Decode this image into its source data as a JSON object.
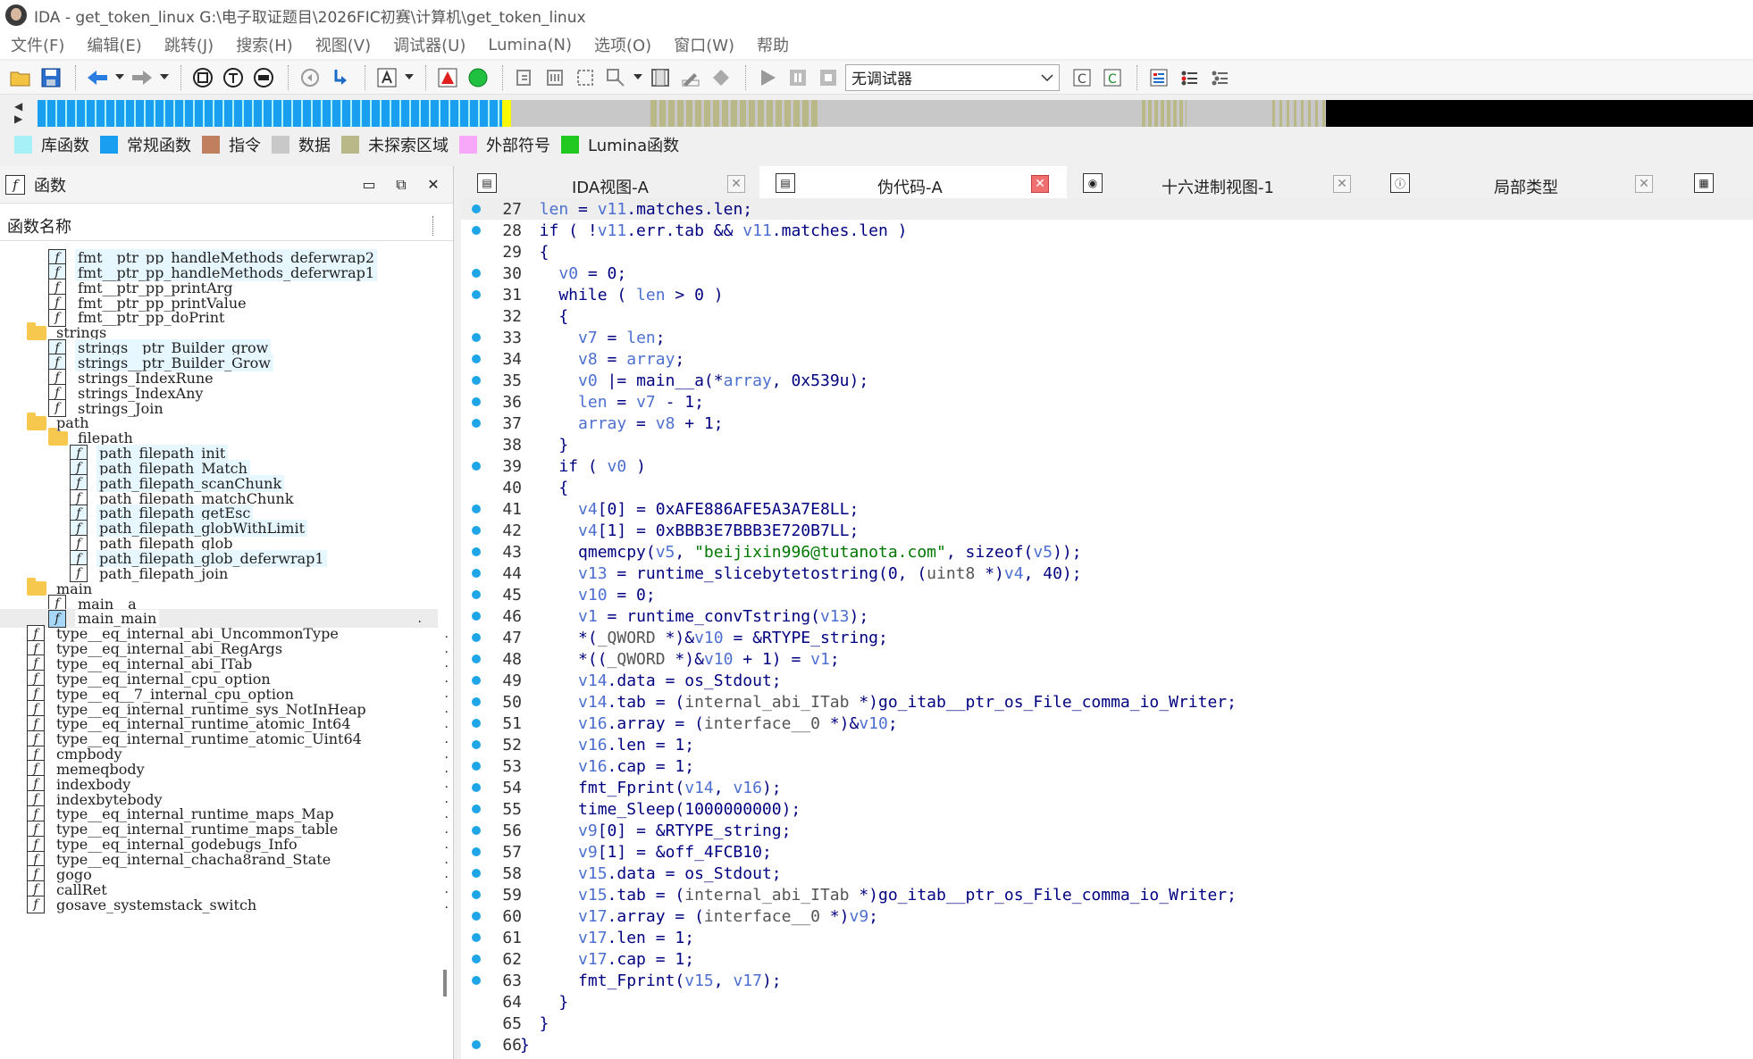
{
  "titlebar": {
    "title": "IDA - get_token_linux G:\\电子取证题目\\2026FIC初赛\\计算机\\get_token_linux"
  },
  "menu": [
    "文件(F)",
    "编辑(E)",
    "跳转(J)",
    "搜索(H)",
    "视图(V)",
    "调试器(U)",
    "Lumina(N)",
    "选项(O)",
    "窗口(W)",
    "帮助"
  ],
  "toolbar": {
    "debugger_select": "无调试器"
  },
  "legend": [
    {
      "label": "库函数",
      "color": "#a8f0f8"
    },
    {
      "label": "常规函数",
      "color": "#1a9ef0"
    },
    {
      "label": "指令",
      "color": "#c08060"
    },
    {
      "label": "数据",
      "color": "#c8c8c8"
    },
    {
      "label": "未探索区域",
      "color": "#b8b888"
    },
    {
      "label": "外部符号",
      "color": "#f8a8f8"
    },
    {
      "label": "Lumina函数",
      "color": "#20c820"
    }
  ],
  "functions_panel": {
    "title": "函数",
    "column_header": "函数名称",
    "rows": [
      {
        "type": "func",
        "indent": 2,
        "name": "fmt__ptr_pp_handleMethods_deferwrap2",
        "lib": true
      },
      {
        "type": "func",
        "indent": 2,
        "name": "fmt__ptr_pp_handleMethods_deferwrap1",
        "lib": true
      },
      {
        "type": "func",
        "indent": 2,
        "name": "fmt__ptr_pp_printArg",
        "lib": false
      },
      {
        "type": "func",
        "indent": 2,
        "name": "fmt__ptr_pp_printValue",
        "lib": false
      },
      {
        "type": "func",
        "indent": 2,
        "name": "fmt__ptr_pp_doPrint",
        "lib": false
      },
      {
        "type": "folder",
        "indent": 1,
        "name": "strings"
      },
      {
        "type": "func",
        "indent": 2,
        "name": "strings__ptr_Builder_grow",
        "lib": true
      },
      {
        "type": "func",
        "indent": 2,
        "name": "strings__ptr_Builder_Grow",
        "lib": true
      },
      {
        "type": "func",
        "indent": 2,
        "name": "strings_IndexRune",
        "lib": false
      },
      {
        "type": "func",
        "indent": 2,
        "name": "strings_IndexAny",
        "lib": false
      },
      {
        "type": "func",
        "indent": 2,
        "name": "strings_Join",
        "lib": false
      },
      {
        "type": "folder",
        "indent": 1,
        "name": "path"
      },
      {
        "type": "folder",
        "indent": 2,
        "name": "filepath"
      },
      {
        "type": "func",
        "indent": 3,
        "name": "path_filepath_init",
        "lib": true
      },
      {
        "type": "func",
        "indent": 3,
        "name": "path_filepath_Match",
        "lib": true
      },
      {
        "type": "func",
        "indent": 3,
        "name": "path_filepath_scanChunk",
        "lib": true
      },
      {
        "type": "func",
        "indent": 3,
        "name": "path_filepath_matchChunk",
        "lib": false
      },
      {
        "type": "func",
        "indent": 3,
        "name": "path_filepath_getEsc",
        "lib": true
      },
      {
        "type": "func",
        "indent": 3,
        "name": "path_filepath_globWithLimit",
        "lib": true
      },
      {
        "type": "func",
        "indent": 3,
        "name": "path_filepath_glob",
        "lib": false
      },
      {
        "type": "func",
        "indent": 3,
        "name": "path_filepath_glob_deferwrap1",
        "lib": true
      },
      {
        "type": "func",
        "indent": 3,
        "name": "path_filepath_join",
        "lib": false
      },
      {
        "type": "folder",
        "indent": 1,
        "name": "main"
      },
      {
        "type": "func",
        "indent": 2,
        "name": "main__a",
        "lib": false
      },
      {
        "type": "func",
        "indent": 2,
        "name": "main_main",
        "lib": false,
        "selected": true
      },
      {
        "type": "func",
        "indent": 1,
        "name": "type__eq_internal_abi_UncommonType",
        "lib": false
      },
      {
        "type": "func",
        "indent": 1,
        "name": "type__eq_internal_abi_RegArgs",
        "lib": false
      },
      {
        "type": "func",
        "indent": 1,
        "name": "type__eq_internal_abi_ITab",
        "lib": false
      },
      {
        "type": "func",
        "indent": 1,
        "name": "type__eq_internal_cpu_option",
        "lib": false
      },
      {
        "type": "func",
        "indent": 1,
        "name": "type__eq__7_internal_cpu_option",
        "lib": false
      },
      {
        "type": "func",
        "indent": 1,
        "name": "type__eq_internal_runtime_sys_NotInHeap",
        "lib": false
      },
      {
        "type": "func",
        "indent": 1,
        "name": "type__eq_internal_runtime_atomic_Int64",
        "lib": false
      },
      {
        "type": "func",
        "indent": 1,
        "name": "type__eq_internal_runtime_atomic_Uint64",
        "lib": false
      },
      {
        "type": "func",
        "indent": 1,
        "name": "cmpbody",
        "lib": false
      },
      {
        "type": "func",
        "indent": 1,
        "name": "memeqbody",
        "lib": false
      },
      {
        "type": "func",
        "indent": 1,
        "name": "indexbody",
        "lib": false
      },
      {
        "type": "func",
        "indent": 1,
        "name": "indexbytebody",
        "lib": false
      },
      {
        "type": "func",
        "indent": 1,
        "name": "type__eq_internal_runtime_maps_Map",
        "lib": false
      },
      {
        "type": "func",
        "indent": 1,
        "name": "type__eq_internal_runtime_maps_table",
        "lib": false
      },
      {
        "type": "func",
        "indent": 1,
        "name": "type__eq_internal_godebugs_Info",
        "lib": false
      },
      {
        "type": "func",
        "indent": 1,
        "name": "type__eq_internal_chacha8rand_State",
        "lib": false
      },
      {
        "type": "func",
        "indent": 1,
        "name": "gogo",
        "lib": false
      },
      {
        "type": "func",
        "indent": 1,
        "name": "callRet",
        "lib": false
      },
      {
        "type": "func",
        "indent": 1,
        "name": "gosave_systemstack_switch",
        "lib": false
      }
    ]
  },
  "tabs": [
    {
      "label": "IDA视图-A",
      "icon": "ida-view-icon",
      "active": false
    },
    {
      "label": "伪代码-A",
      "icon": "pseudocode-icon",
      "active": true
    },
    {
      "label": "十六进制视图-1",
      "icon": "hex-view-icon",
      "active": false
    },
    {
      "label": "局部类型",
      "icon": "local-types-icon",
      "active": false
    }
  ],
  "code_lines": [
    {
      "n": "27",
      "bp": true,
      "text": "  len = v11.matches.len;",
      "cur": true
    },
    {
      "n": "28",
      "bp": true,
      "text": "  if ( !v11.err.tab && v11.matches.len )"
    },
    {
      "n": "29",
      "bp": false,
      "text": "  {"
    },
    {
      "n": "30",
      "bp": true,
      "text": "    v0 = 0;"
    },
    {
      "n": "31",
      "bp": true,
      "text": "    while ( len > 0 )"
    },
    {
      "n": "32",
      "bp": false,
      "text": "    {"
    },
    {
      "n": "33",
      "bp": true,
      "text": "      v7 = len;"
    },
    {
      "n": "34",
      "bp": true,
      "text": "      v8 = array;"
    },
    {
      "n": "35",
      "bp": true,
      "text": "      v0 |= main__a(*array, 0x539u);"
    },
    {
      "n": "36",
      "bp": true,
      "text": "      len = v7 - 1;"
    },
    {
      "n": "37",
      "bp": true,
      "text": "      array = v8 + 1;"
    },
    {
      "n": "38",
      "bp": false,
      "text": "    }"
    },
    {
      "n": "39",
      "bp": true,
      "text": "    if ( v0 )"
    },
    {
      "n": "40",
      "bp": false,
      "text": "    {"
    },
    {
      "n": "41",
      "bp": true,
      "text": "      v4[0] = 0xAFE886AFE5A3A7E8LL;"
    },
    {
      "n": "42",
      "bp": true,
      "text": "      v4[1] = 0xBBB3E7BBB3E720B7LL;"
    },
    {
      "n": "43",
      "bp": true,
      "text": "      qmemcpy(v5, \"beijixin996@tutanota.com\", sizeof(v5));"
    },
    {
      "n": "44",
      "bp": true,
      "text": "      v13 = runtime_slicebytetostring(0, (uint8 *)v4, 40);"
    },
    {
      "n": "45",
      "bp": true,
      "text": "      v10 = 0;"
    },
    {
      "n": "46",
      "bp": true,
      "text": "      v1 = runtime_convTstring(v13);"
    },
    {
      "n": "47",
      "bp": true,
      "text": "      *(_QWORD *)&v10 = &RTYPE_string;"
    },
    {
      "n": "48",
      "bp": true,
      "text": "      *((_QWORD *)&v10 + 1) = v1;"
    },
    {
      "n": "49",
      "bp": true,
      "text": "      v14.data = os_Stdout;"
    },
    {
      "n": "50",
      "bp": true,
      "text": "      v14.tab = (internal_abi_ITab *)go_itab__ptr_os_File_comma_io_Writer;"
    },
    {
      "n": "51",
      "bp": true,
      "text": "      v16.array = (interface__0 *)&v10;"
    },
    {
      "n": "52",
      "bp": true,
      "text": "      v16.len = 1;"
    },
    {
      "n": "53",
      "bp": true,
      "text": "      v16.cap = 1;"
    },
    {
      "n": "54",
      "bp": true,
      "text": "      fmt_Fprint(v14, v16);"
    },
    {
      "n": "55",
      "bp": true,
      "text": "      time_Sleep(1000000000);"
    },
    {
      "n": "56",
      "bp": true,
      "text": "      v9[0] = &RTYPE_string;"
    },
    {
      "n": "57",
      "bp": true,
      "text": "      v9[1] = &off_4FCB10;"
    },
    {
      "n": "58",
      "bp": true,
      "text": "      v15.data = os_Stdout;"
    },
    {
      "n": "59",
      "bp": true,
      "text": "      v15.tab = (internal_abi_ITab *)go_itab__ptr_os_File_comma_io_Writer;"
    },
    {
      "n": "60",
      "bp": true,
      "text": "      v17.array = (interface__0 *)v9;"
    },
    {
      "n": "61",
      "bp": true,
      "text": "      v17.len = 1;"
    },
    {
      "n": "62",
      "bp": true,
      "text": "      v17.cap = 1;"
    },
    {
      "n": "63",
      "bp": true,
      "text": "      fmt_Fprint(v15, v17);"
    },
    {
      "n": "64",
      "bp": false,
      "text": "    }"
    },
    {
      "n": "65",
      "bp": false,
      "text": "  }"
    },
    {
      "n": "66",
      "bp": true,
      "text": "}"
    }
  ]
}
